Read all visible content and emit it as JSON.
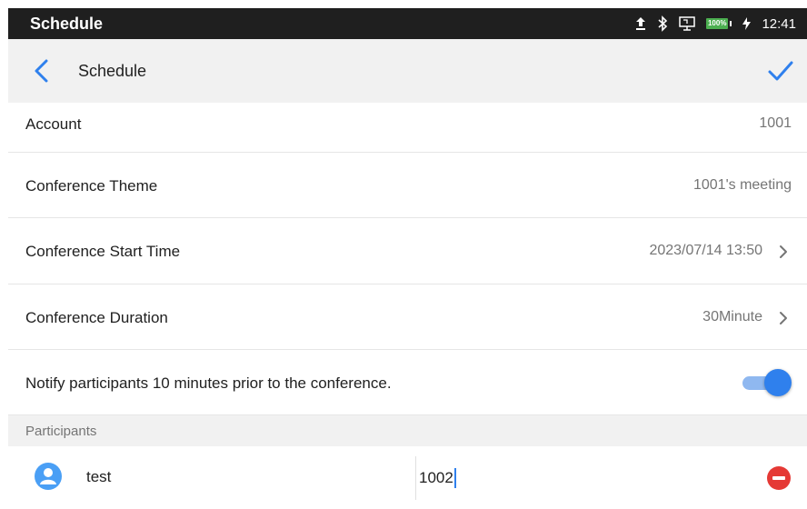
{
  "status_bar": {
    "app_title": "Schedule",
    "time": "12:41",
    "battery": "100%",
    "icons": [
      "upload-icon",
      "bluetooth-icon",
      "screen-share-icon",
      "battery-icon",
      "charging-icon"
    ]
  },
  "header": {
    "title": "Schedule",
    "back_icon": "chevron-left-icon",
    "confirm_icon": "checkmark-icon"
  },
  "form": {
    "account": {
      "label": "Account",
      "value": "1001"
    },
    "theme": {
      "label": "Conference Theme",
      "value": "1001's meeting"
    },
    "start_time": {
      "label": "Conference Start Time",
      "value": "2023/07/14 13:50"
    },
    "duration": {
      "label": "Conference Duration",
      "value": "30Minute"
    },
    "notify": {
      "label": "Notify participants 10 minutes prior to the conference.",
      "enabled": true
    }
  },
  "participants": {
    "section_label": "Participants",
    "items": [
      {
        "name": "test",
        "number": "1002"
      }
    ]
  },
  "colors": {
    "accent": "#2f80ed",
    "remove": "#e53935",
    "status_bar_bg": "#1f1f1f",
    "header_bg": "#f1f1f1"
  }
}
